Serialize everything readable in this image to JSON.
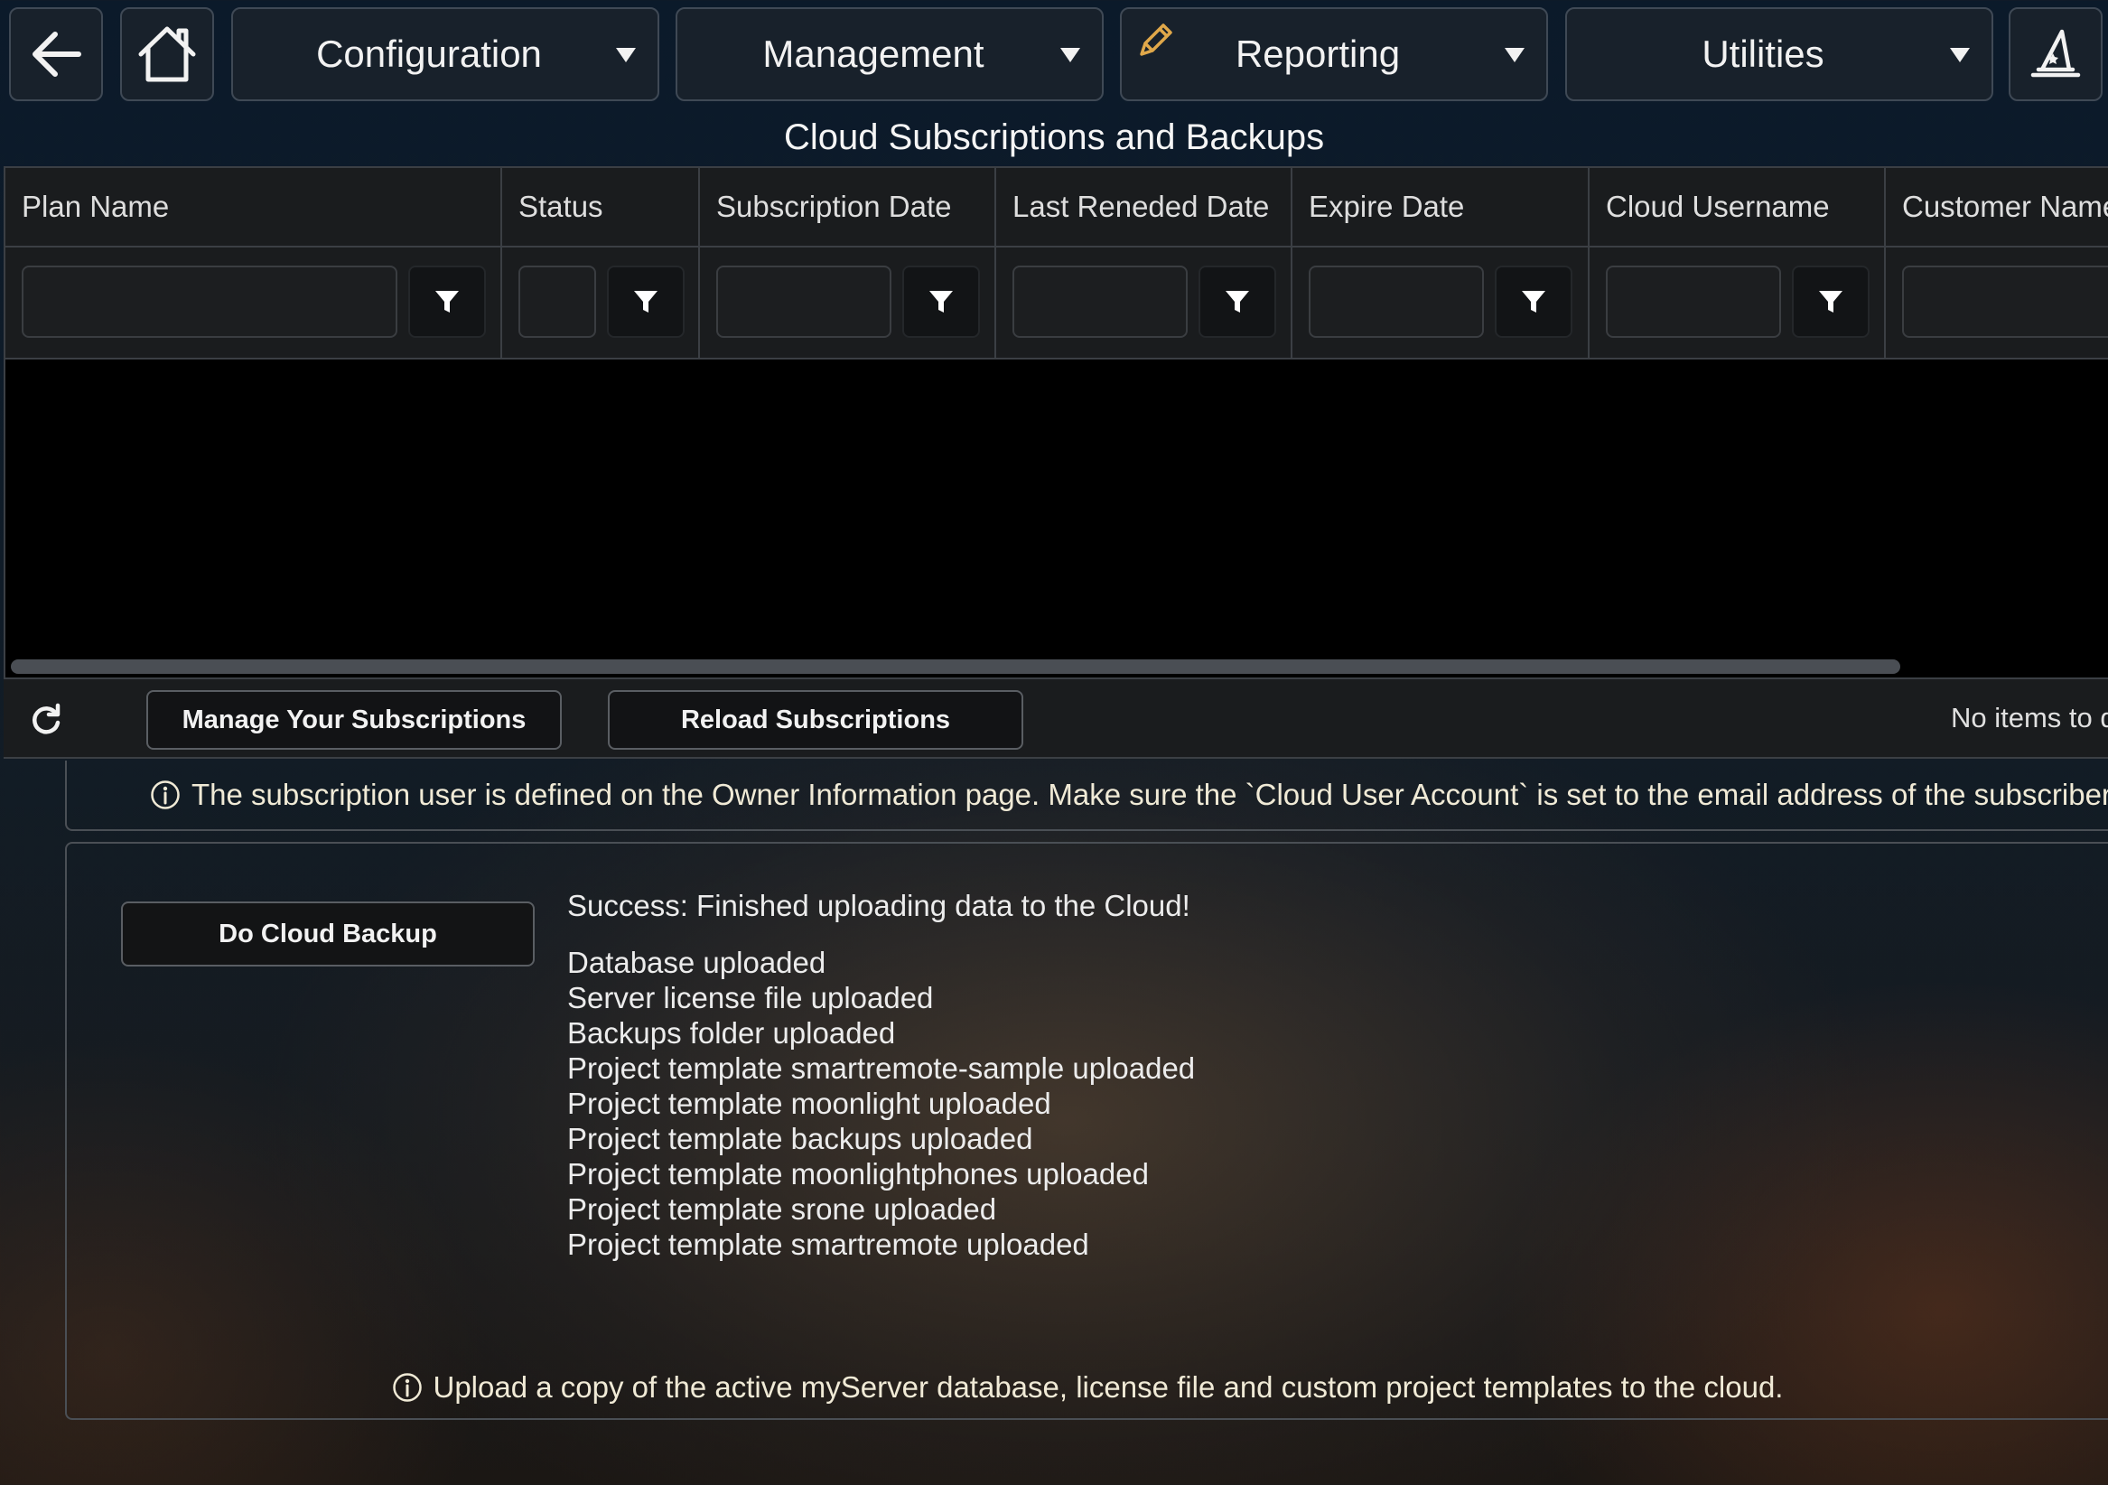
{
  "nav": {
    "back_icon": "arrow-left-icon",
    "home_icon": "home-icon",
    "menus": [
      {
        "label": "Configuration",
        "icon": "caret-down-icon"
      },
      {
        "label": "Management",
        "icon": "caret-down-icon"
      },
      {
        "label": "Reporting",
        "icon": "caret-down-icon",
        "badge_icon": "pencil-icon",
        "badge_color": "#e0a84a"
      },
      {
        "label": "Utilities",
        "icon": "caret-down-icon"
      }
    ],
    "wizard_icon": "wizard-hat-icon"
  },
  "page": {
    "title": "Cloud Subscriptions and Backups"
  },
  "grid": {
    "columns": [
      {
        "label": "Plan Name",
        "filter_value": ""
      },
      {
        "label": "Status",
        "filter_value": ""
      },
      {
        "label": "Subscription Date",
        "filter_value": ""
      },
      {
        "label": "Last Reneded Date",
        "filter_value": ""
      },
      {
        "label": "Expire Date",
        "filter_value": ""
      },
      {
        "label": "Cloud Username",
        "filter_value": ""
      },
      {
        "label": "Customer Name",
        "filter_value": ""
      }
    ],
    "rows": [],
    "filter_icon": "filter-icon"
  },
  "pager": {
    "refresh_icon": "refresh-icon",
    "manage_label": "Manage Your Subscriptions",
    "reload_label": "Reload Subscriptions",
    "status_text": "No items to d"
  },
  "info": {
    "icon": "info-circle-icon",
    "text": "The subscription user is defined on the Owner Information page. Make sure the `Cloud User Account` is set to the email address of the subscriber!"
  },
  "backup": {
    "button_label": "Do Cloud Backup",
    "result_title": "Success: Finished uploading data to the Cloud!",
    "results": [
      "Database uploaded",
      "Server license file uploaded",
      "Backups folder uploaded",
      "Project template smartremote-sample uploaded",
      "Project template moonlight uploaded",
      "Project template backups uploaded",
      "Project template moonlightphones uploaded",
      "Project template srone uploaded",
      "Project template smartremote uploaded"
    ],
    "footer_icon": "info-circle-icon",
    "footer_note": "Upload a copy of the active myServer database, license file and custom project templates to the cloud."
  },
  "colors": {
    "accent_pencil": "#e0a84a",
    "info_text": "#f0ead6",
    "grid_background": "#000000"
  }
}
